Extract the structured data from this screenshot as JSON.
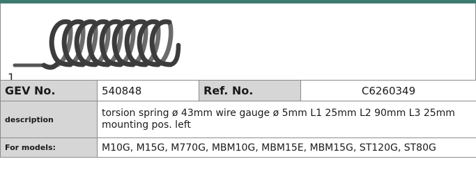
{
  "figure": {
    "label": "1",
    "icon": "torsion-spring-illustration"
  },
  "colors": {
    "accent_bar": "#3d7a70",
    "label_cell_bg": "#d6d6d6",
    "border": "#8a8a8a"
  },
  "table": {
    "gev_label": "GEV No.",
    "gev_value": "540848",
    "ref_label": "Ref. No.",
    "ref_value": "C6260349",
    "description_label": "description",
    "description_value": "torsion spring  ø 43mm wire gauge ø 5mm L1 25mm L2 90mm L3 25mm mounting pos. left",
    "models_label": "For models:",
    "models_value": "M10G, M15G, M770G, MBM10G, MBM15E, MBM15G, ST120G, ST80G"
  }
}
